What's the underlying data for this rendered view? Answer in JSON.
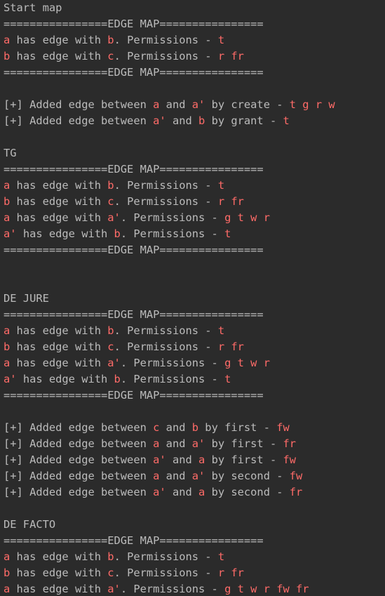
{
  "colors": {
    "background": "#2b2b2b",
    "text": "#bbbbbb",
    "highlight": "#ff6b68"
  },
  "lines": [
    [
      {
        "t": "Start map"
      }
    ],
    [
      {
        "t": "================EDGE MAP================"
      }
    ],
    [
      {
        "t": "a",
        "hl": true
      },
      {
        "t": " has edge with "
      },
      {
        "t": "b",
        "hl": true
      },
      {
        "t": ". Permissions - "
      },
      {
        "t": "t",
        "hl": true
      }
    ],
    [
      {
        "t": "b",
        "hl": true
      },
      {
        "t": " has edge with "
      },
      {
        "t": "c",
        "hl": true
      },
      {
        "t": ". Permissions - "
      },
      {
        "t": "r fr",
        "hl": true
      }
    ],
    [
      {
        "t": "================EDGE MAP================"
      }
    ],
    [
      {
        "t": ""
      }
    ],
    [
      {
        "t": "[+] Added edge between "
      },
      {
        "t": "a",
        "hl": true
      },
      {
        "t": " and "
      },
      {
        "t": "a'",
        "hl": true
      },
      {
        "t": " by create - "
      },
      {
        "t": "t g r w",
        "hl": true
      }
    ],
    [
      {
        "t": "[+] Added edge between "
      },
      {
        "t": "a'",
        "hl": true
      },
      {
        "t": " and "
      },
      {
        "t": "b",
        "hl": true
      },
      {
        "t": " by grant - "
      },
      {
        "t": "t",
        "hl": true
      }
    ],
    [
      {
        "t": ""
      }
    ],
    [
      {
        "t": "TG"
      }
    ],
    [
      {
        "t": "================EDGE MAP================"
      }
    ],
    [
      {
        "t": "a",
        "hl": true
      },
      {
        "t": " has edge with "
      },
      {
        "t": "b",
        "hl": true
      },
      {
        "t": ". Permissions - "
      },
      {
        "t": "t",
        "hl": true
      }
    ],
    [
      {
        "t": "b",
        "hl": true
      },
      {
        "t": " has edge with "
      },
      {
        "t": "c",
        "hl": true
      },
      {
        "t": ". Permissions - "
      },
      {
        "t": "r fr",
        "hl": true
      }
    ],
    [
      {
        "t": "a",
        "hl": true
      },
      {
        "t": " has edge with "
      },
      {
        "t": "a'",
        "hl": true
      },
      {
        "t": ". Permissions - "
      },
      {
        "t": "g t w r",
        "hl": true
      }
    ],
    [
      {
        "t": "a'",
        "hl": true
      },
      {
        "t": " has edge with "
      },
      {
        "t": "b",
        "hl": true
      },
      {
        "t": ". Permissions - "
      },
      {
        "t": "t",
        "hl": true
      }
    ],
    [
      {
        "t": "================EDGE MAP================"
      }
    ],
    [
      {
        "t": ""
      }
    ],
    [
      {
        "t": ""
      }
    ],
    [
      {
        "t": "DE JURE"
      }
    ],
    [
      {
        "t": "================EDGE MAP================"
      }
    ],
    [
      {
        "t": "a",
        "hl": true
      },
      {
        "t": " has edge with "
      },
      {
        "t": "b",
        "hl": true
      },
      {
        "t": ". Permissions - "
      },
      {
        "t": "t",
        "hl": true
      }
    ],
    [
      {
        "t": "b",
        "hl": true
      },
      {
        "t": " has edge with "
      },
      {
        "t": "c",
        "hl": true
      },
      {
        "t": ". Permissions - "
      },
      {
        "t": "r fr",
        "hl": true
      }
    ],
    [
      {
        "t": "a",
        "hl": true
      },
      {
        "t": " has edge with "
      },
      {
        "t": "a'",
        "hl": true
      },
      {
        "t": ". Permissions - "
      },
      {
        "t": "g t w r",
        "hl": true
      }
    ],
    [
      {
        "t": "a'",
        "hl": true
      },
      {
        "t": " has edge with "
      },
      {
        "t": "b",
        "hl": true
      },
      {
        "t": ". Permissions - "
      },
      {
        "t": "t",
        "hl": true
      }
    ],
    [
      {
        "t": "================EDGE MAP================"
      }
    ],
    [
      {
        "t": ""
      }
    ],
    [
      {
        "t": "[+] Added edge between "
      },
      {
        "t": "c",
        "hl": true
      },
      {
        "t": " and "
      },
      {
        "t": "b",
        "hl": true
      },
      {
        "t": " by first - "
      },
      {
        "t": "fw",
        "hl": true
      }
    ],
    [
      {
        "t": "[+] Added edge between "
      },
      {
        "t": "a",
        "hl": true
      },
      {
        "t": " and "
      },
      {
        "t": "a'",
        "hl": true
      },
      {
        "t": " by first - "
      },
      {
        "t": "fr",
        "hl": true
      }
    ],
    [
      {
        "t": "[+] Added edge between "
      },
      {
        "t": "a'",
        "hl": true
      },
      {
        "t": " and "
      },
      {
        "t": "a",
        "hl": true
      },
      {
        "t": " by first - "
      },
      {
        "t": "fw",
        "hl": true
      }
    ],
    [
      {
        "t": "[+] Added edge between "
      },
      {
        "t": "a",
        "hl": true
      },
      {
        "t": " and "
      },
      {
        "t": "a'",
        "hl": true
      },
      {
        "t": " by second - "
      },
      {
        "t": "fw",
        "hl": true
      }
    ],
    [
      {
        "t": "[+] Added edge between "
      },
      {
        "t": "a'",
        "hl": true
      },
      {
        "t": " and "
      },
      {
        "t": "a",
        "hl": true
      },
      {
        "t": " by second - "
      },
      {
        "t": "fr",
        "hl": true
      }
    ],
    [
      {
        "t": ""
      }
    ],
    [
      {
        "t": "DE FACTO"
      }
    ],
    [
      {
        "t": "================EDGE MAP================"
      }
    ],
    [
      {
        "t": "a",
        "hl": true
      },
      {
        "t": " has edge with "
      },
      {
        "t": "b",
        "hl": true
      },
      {
        "t": ". Permissions - "
      },
      {
        "t": "t",
        "hl": true
      }
    ],
    [
      {
        "t": "b",
        "hl": true
      },
      {
        "t": " has edge with "
      },
      {
        "t": "c",
        "hl": true
      },
      {
        "t": ". Permissions - "
      },
      {
        "t": "r fr",
        "hl": true
      }
    ],
    [
      {
        "t": "a",
        "hl": true
      },
      {
        "t": " has edge with "
      },
      {
        "t": "a'",
        "hl": true
      },
      {
        "t": ". Permissions - "
      },
      {
        "t": "g t w r fw fr",
        "hl": true
      }
    ]
  ]
}
